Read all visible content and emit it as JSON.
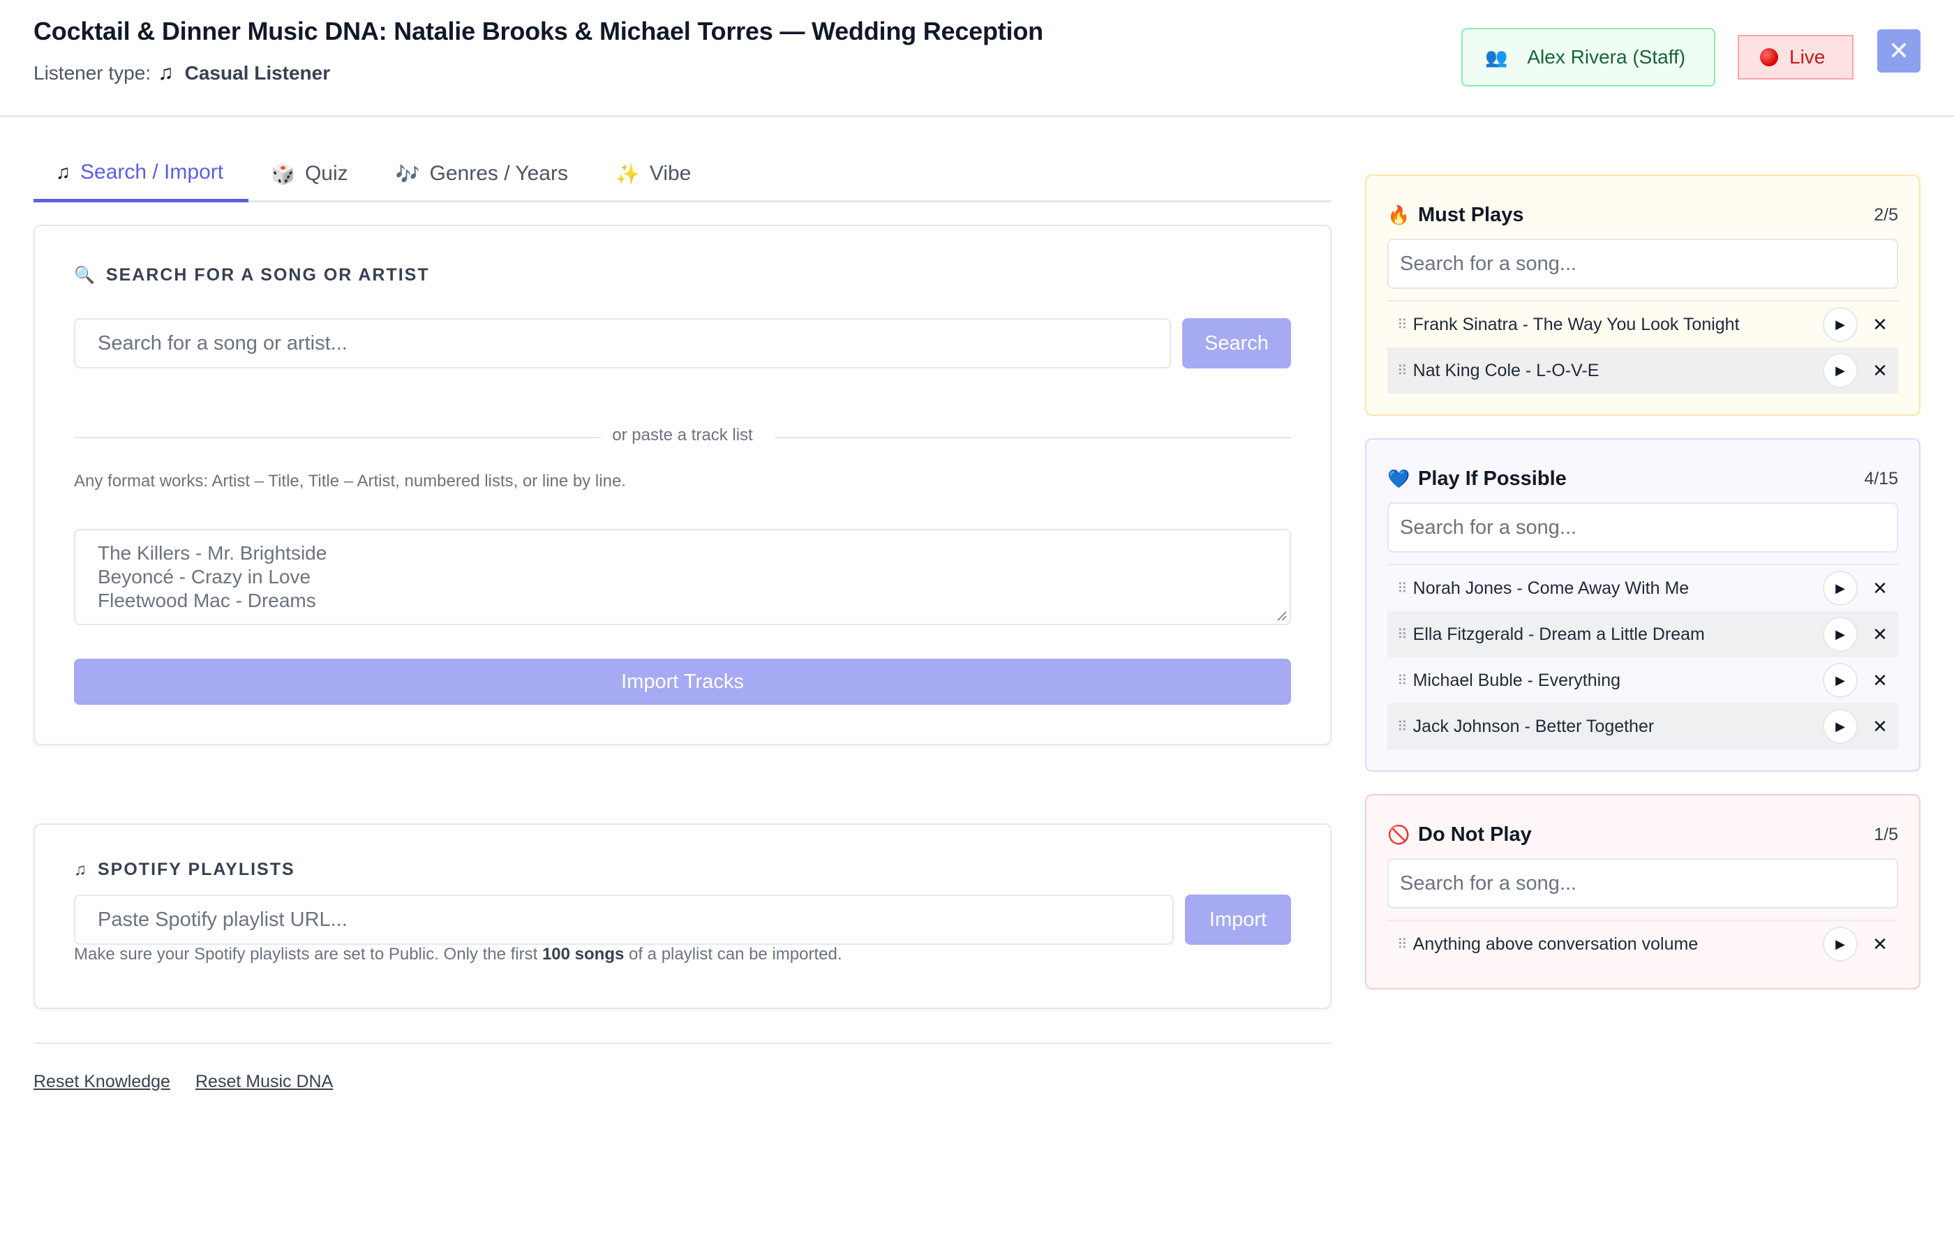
{
  "header": {
    "title": "Cocktail & Dinner Music DNA: Natalie Brooks & Michael Torres — Wedding Reception",
    "listener_label": "Listener type:",
    "listener_icon": "♫",
    "listener_type": "Casual Listener",
    "staff_icon": "👥",
    "staff_label": "Alex Rivera (Staff)",
    "live_label": "Live",
    "close_icon": "✕"
  },
  "tabs": [
    {
      "icon": "♫",
      "label": "Search / Import",
      "active": true
    },
    {
      "icon": "🎲",
      "label": "Quiz",
      "active": false
    },
    {
      "icon": "🎶",
      "label": "Genres / Years",
      "active": false
    },
    {
      "icon": "✨",
      "label": "Vibe",
      "active": false
    }
  ],
  "search_section": {
    "icon": "🔍",
    "title": "SEARCH FOR A SONG OR ARTIST",
    "placeholder": "Search for a song or artist...",
    "search_button": "Search",
    "divider_text": "or paste a track list",
    "hint": "Any format works: Artist – Title, Title – Artist, numbered lists, or line by line.",
    "textarea_placeholder": [
      "The Killers - Mr. Brightside",
      "Beyoncé - Crazy in Love",
      "Fleetwood Mac - Dreams"
    ],
    "import_button": "Import Tracks"
  },
  "spotify_section": {
    "icon": "♫",
    "title": "SPOTIFY PLAYLISTS",
    "placeholder": "Paste Spotify playlist URL...",
    "import_button": "Import",
    "note_before": "Make sure your Spotify playlists are set to Public. Only the first ",
    "note_bold": "100 songs",
    "note_after": " of a playlist can be imported."
  },
  "footer_links": {
    "reset_knowledge": "Reset Knowledge",
    "reset_dna": "Reset Music DNA"
  },
  "panels": {
    "must_plays": {
      "icon": "🔥",
      "title": "Must Plays",
      "count": "2/5",
      "placeholder": "Search for a song...",
      "songs": [
        "Frank Sinatra - The Way You Look Tonight",
        "Nat King Cole - L-O-V-E"
      ]
    },
    "play_if_possible": {
      "icon": "💙",
      "title": "Play If Possible",
      "count": "4/15",
      "placeholder": "Search for a song...",
      "songs": [
        "Norah Jones - Come Away With Me",
        "Ella Fitzgerald - Dream a Little Dream",
        "Michael Buble - Everything",
        "Jack Johnson - Better Together"
      ]
    },
    "do_not_play": {
      "icon": "🚫",
      "title": "Do Not Play",
      "count": "1/5",
      "placeholder": "Search for a song...",
      "songs": [
        "Anything above conversation volume"
      ]
    }
  },
  "icons": {
    "grip": "⠿",
    "play": "▶",
    "remove": "✕"
  },
  "colors": {
    "accent": "#5b5fe0",
    "button_disabled": "#a5aaf2",
    "live_red": "#b91c1c",
    "staff_green": "#166534"
  }
}
